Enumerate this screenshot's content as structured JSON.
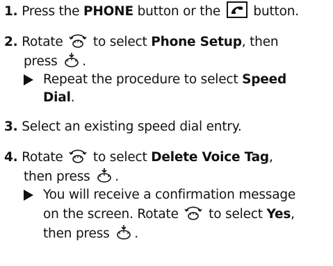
{
  "steps": [
    {
      "num": "1.",
      "t1": " Press the ",
      "b1": "PHONE",
      "t2": " button or the ",
      "t3": " button."
    },
    {
      "num": "2.",
      "t1": " Rotate ",
      "t2": " to select ",
      "b1": "Phone Setup",
      "t3": ", then",
      "t4": "press ",
      "t5": ".",
      "sub_t1": "Repeat the procedure to select ",
      "sub_b1": "Speed",
      "sub_b2": "Dial",
      "sub_t2": "."
    },
    {
      "num": "3.",
      "t1": " Select an existing speed dial entry."
    },
    {
      "num": "4.",
      "t1": " Rotate ",
      "t2": " to select ",
      "b1": "Delete Voice Tag",
      "t3": ",",
      "t4": "then press ",
      "t5": ".",
      "sub_l1": "You will receive a confirmation message",
      "sub_l2a": "on the screen. Rotate ",
      "sub_l2b": " to select ",
      "sub_b1": "Yes",
      "sub_l2c": ",",
      "sub_l3a": "then press ",
      "sub_l3b": "."
    }
  ],
  "icons": {
    "phone_button": "phone-button-icon",
    "rotate": "interface-dial-rotate-icon",
    "press": "interface-dial-press-icon"
  },
  "colors": {
    "text": "#111111",
    "background": "#ffffff"
  }
}
